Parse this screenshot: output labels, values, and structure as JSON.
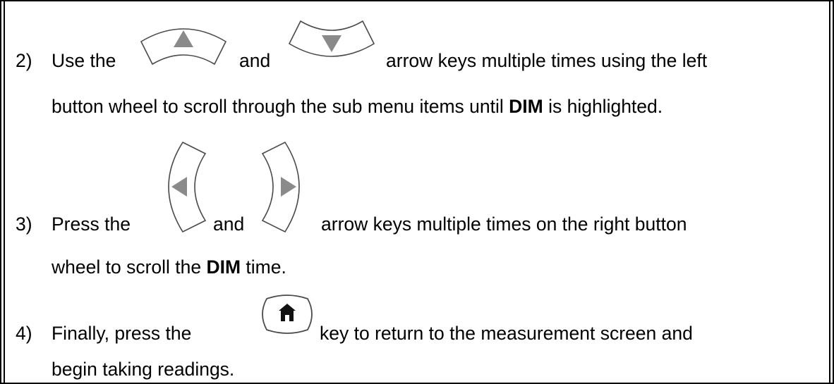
{
  "steps": [
    {
      "number": "2)",
      "line1": {
        "a": "Use the",
        "b": "and",
        "c": "arrow keys multiple times using the left"
      },
      "line2": {
        "a": "button wheel to scroll through the sub menu items until ",
        "bold": "DIM",
        "c": " is highlighted."
      },
      "icons": [
        "up-arrow-key-icon",
        "down-arrow-key-icon"
      ]
    },
    {
      "number": "3)",
      "line1": {
        "a": "Press the",
        "b": "and",
        "c": "arrow keys multiple times on the right button"
      },
      "line2": {
        "a": "wheel to scroll the ",
        "bold": "DIM",
        "c": " time."
      },
      "icons": [
        "left-arrow-key-icon",
        "right-arrow-key-icon"
      ]
    },
    {
      "number": "4)",
      "line1": {
        "a": "Finally, press the",
        "c": "key to return to the measurement screen and"
      },
      "line2": {
        "a": "begin taking readings."
      },
      "icons": [
        "home-key-icon"
      ]
    }
  ],
  "colors": {
    "key_outline": "#4a4a4a",
    "key_symbol": "#8a8a8a",
    "border": "#000000"
  }
}
